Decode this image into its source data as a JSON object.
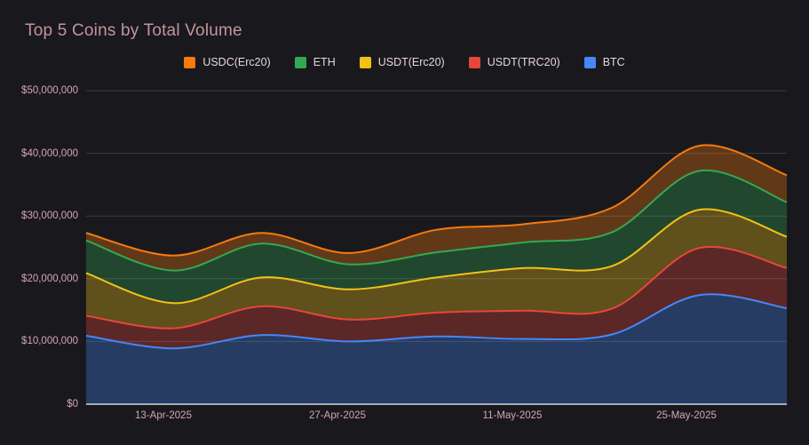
{
  "title": "Top 5 Coins by Total Volume",
  "colors": {
    "background": "#19191d",
    "title_text": "#c4939b",
    "axis_label": "#d4a7ae",
    "gridline": "#3e3e42",
    "zero_line": "#e8eaed",
    "fill_opacity": 0.33
  },
  "legend": {
    "position": "top",
    "items": [
      {
        "label": "USDC(Erc20)",
        "color": "#f57b0f"
      },
      {
        "label": "ETH",
        "color": "#34a853"
      },
      {
        "label": "USDT(Erc20)",
        "color": "#f3c118"
      },
      {
        "label": "USDT(TRC20)",
        "color": "#e8453c"
      },
      {
        "label": "BTC",
        "color": "#4687f4"
      }
    ]
  },
  "chart_data": {
    "type": "area",
    "stacked": true,
    "title": "Top 5 Coins by Total Volume",
    "xlabel": "",
    "ylabel": "",
    "ylim": [
      0,
      50000000
    ],
    "grid": true,
    "legend_position": "top",
    "y_ticks": [
      "$0",
      "$10,000,000",
      "$20,000,000",
      "$30,000,000",
      "$40,000,000",
      "$50,000,000"
    ],
    "x_ticks": [
      {
        "label": "13-Apr-2025",
        "frac": 0.11
      },
      {
        "label": "27-Apr-2025",
        "frac": 0.359
      },
      {
        "label": "11-May-2025",
        "frac": 0.608
      },
      {
        "label": "25-May-2025",
        "frac": 0.857
      }
    ],
    "series": [
      {
        "name": "BTC",
        "color": "#4687f4",
        "values": [
          10900000,
          8900000,
          11000000,
          10000000,
          10800000,
          10400000,
          11100000,
          17400000,
          15300000
        ]
      },
      {
        "name": "USDT(TRC20)",
        "color": "#e8453c",
        "values": [
          3200000,
          3200000,
          4600000,
          3500000,
          3800000,
          4500000,
          4100000,
          7500000,
          6400000
        ]
      },
      {
        "name": "USDT(Erc20)",
        "color": "#f3c118",
        "values": [
          6800000,
          4000000,
          4600000,
          4800000,
          5600000,
          6800000,
          6800000,
          6100000,
          5000000
        ]
      },
      {
        "name": "ETH",
        "color": "#34a853",
        "values": [
          5200000,
          5200000,
          5400000,
          4000000,
          4000000,
          4100000,
          5400000,
          6200000,
          5500000
        ]
      },
      {
        "name": "USDC(Erc20)",
        "color": "#f57b0f",
        "values": [
          1200000,
          2400000,
          1700000,
          1800000,
          3600000,
          2900000,
          3900000,
          4000000,
          4300000
        ]
      }
    ]
  }
}
